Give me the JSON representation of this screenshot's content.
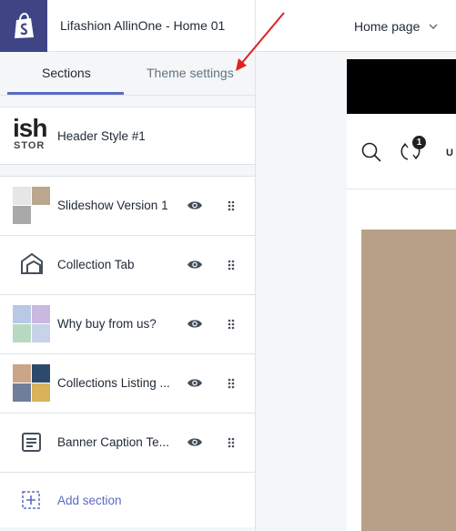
{
  "app": {
    "title": "Lifashion AllinOne - Home 01"
  },
  "page_select": {
    "value": "Home page"
  },
  "tabs": [
    {
      "label": "Sections",
      "active": true
    },
    {
      "label": "Theme settings",
      "active": false
    }
  ],
  "header_section": {
    "label": "Header Style #1",
    "thumb_big": "ish",
    "thumb_small": "STOR"
  },
  "sections": [
    {
      "label": "Slideshow Version 1",
      "icon": "image-thumbnail"
    },
    {
      "label": "Collection Tab",
      "icon": "collection-icon"
    },
    {
      "label": "Why buy from us?",
      "icon": "image-thumbnail"
    },
    {
      "label": "Collections Listing ...",
      "icon": "image-thumbnail"
    },
    {
      "label": "Banner Caption Te...",
      "icon": "text-block-icon"
    }
  ],
  "add_section": {
    "label": "Add section"
  },
  "preview": {
    "compare_count": "1",
    "header_cut_text": "U"
  },
  "colors": {
    "accent": "#5c6ac4",
    "logo_bg": "#3f4485",
    "arrow": "#e02020",
    "preview_image": "#b8a088"
  }
}
